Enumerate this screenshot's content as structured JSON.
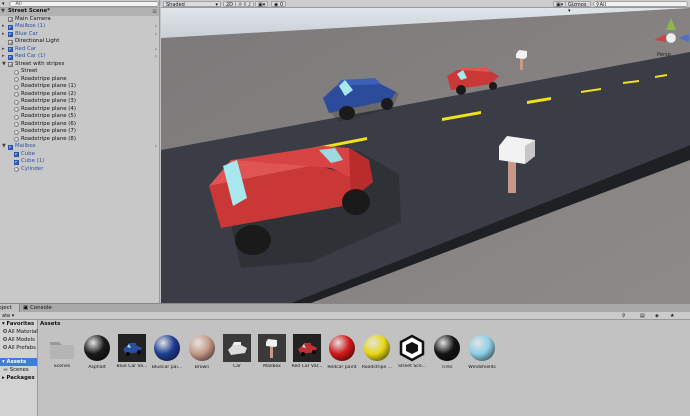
{
  "hierarchy": {
    "search_placeholder": "All",
    "scene_name": "Street Scene*",
    "items": [
      {
        "label": "Main Camera",
        "icon": "cube-icon",
        "blue": false
      },
      {
        "label": "Mailbox (1)",
        "icon": "cube-icon",
        "blue": true,
        "arrow": true
      },
      {
        "label": "Blue Car",
        "icon": "cube-icon",
        "blue": true,
        "arrow": true
      },
      {
        "label": "Directional Light",
        "icon": "cube-icon",
        "blue": false
      },
      {
        "label": "Red Car",
        "icon": "cube-icon",
        "blue": true,
        "arrow": true
      },
      {
        "label": "Red Car (1)",
        "icon": "cube-icon",
        "blue": true,
        "arrow": true
      },
      {
        "label": "Street with stripes",
        "icon": "cube-icon",
        "blue": false
      },
      {
        "label": "Street",
        "icon": "sphere-icon",
        "blue": false
      },
      {
        "label": "Roadstripe plane",
        "icon": "sphere-icon",
        "blue": false
      },
      {
        "label": "Roadstripe plane (1)",
        "icon": "sphere-icon",
        "blue": false
      },
      {
        "label": "Roadstripe plane (2)",
        "icon": "sphere-icon",
        "blue": false
      },
      {
        "label": "Roadstripe plane (3)",
        "icon": "sphere-icon",
        "blue": false
      },
      {
        "label": "Roadstripe plane (4)",
        "icon": "sphere-icon",
        "blue": false
      },
      {
        "label": "Roadstripe plane (5)",
        "icon": "sphere-icon",
        "blue": false
      },
      {
        "label": "Roadstripe plane (6)",
        "icon": "sphere-icon",
        "blue": false
      },
      {
        "label": "Roadstripe plane (7)",
        "icon": "sphere-icon",
        "blue": false
      },
      {
        "label": "Roadstripe plane (8)",
        "icon": "sphere-icon",
        "blue": false
      },
      {
        "label": "Mailbox",
        "icon": "cube-icon",
        "blue": true,
        "arrow": true
      },
      {
        "label": "Cube",
        "icon": "cube-icon",
        "blue": true
      },
      {
        "label": "Cube (1)",
        "icon": "cube-icon",
        "blue": true
      },
      {
        "label": "Cylinder",
        "icon": "sphere-icon",
        "blue": true
      }
    ]
  },
  "scene_toolbar": {
    "shading_mode": "Shaded",
    "mode_2d": "2D",
    "gizmos": "Gizmos",
    "search_placeholder": "All",
    "persp_label": "Persp"
  },
  "bottom": {
    "tab_project": "Project",
    "tab_console": "Console"
  },
  "favorites": {
    "title": "Favorites",
    "items": [
      "All Materials",
      "All Models",
      "All Prefabs"
    ],
    "assets_label": "Assets",
    "scenes_label": "Scenes",
    "packages_label": "Packages"
  },
  "assets": {
    "title": "Assets",
    "items": [
      {
        "name": "Scenes",
        "kind": "folder"
      },
      {
        "name": "Asphalt",
        "kind": "ball",
        "color": "#1a1a1a"
      },
      {
        "name": "Blue Car Va...",
        "kind": "car",
        "color": "#2c4ea0"
      },
      {
        "name": "Bluecar pai...",
        "kind": "ball",
        "color": "#1f3f95"
      },
      {
        "name": "Brown",
        "kind": "ball",
        "color": "#c79a88"
      },
      {
        "name": "Car",
        "kind": "carmesh",
        "color": "#dcdcdc"
      },
      {
        "name": "Mailbox",
        "kind": "mailbox",
        "color": "#e8e8e8"
      },
      {
        "name": "Red Car Var...",
        "kind": "car",
        "color": "#c23131"
      },
      {
        "name": "Redcar paint",
        "kind": "ball",
        "color": "#d11a1a"
      },
      {
        "name": "Roadstripe ...",
        "kind": "ball",
        "color": "#e8d814"
      },
      {
        "name": "Street Sce...",
        "kind": "unity",
        "color": "#111111"
      },
      {
        "name": "Tires",
        "kind": "ball",
        "color": "#141414"
      },
      {
        "name": "Windshields",
        "kind": "ball",
        "color": "#8fd0e6"
      }
    ]
  },
  "colors": {
    "selection": "#3e7ce0",
    "ground": "#8d8d8d",
    "road": "#3a3d45",
    "stripe": "#f2e21a",
    "red_car": "#d64141",
    "blue_car": "#2e4f9e"
  }
}
